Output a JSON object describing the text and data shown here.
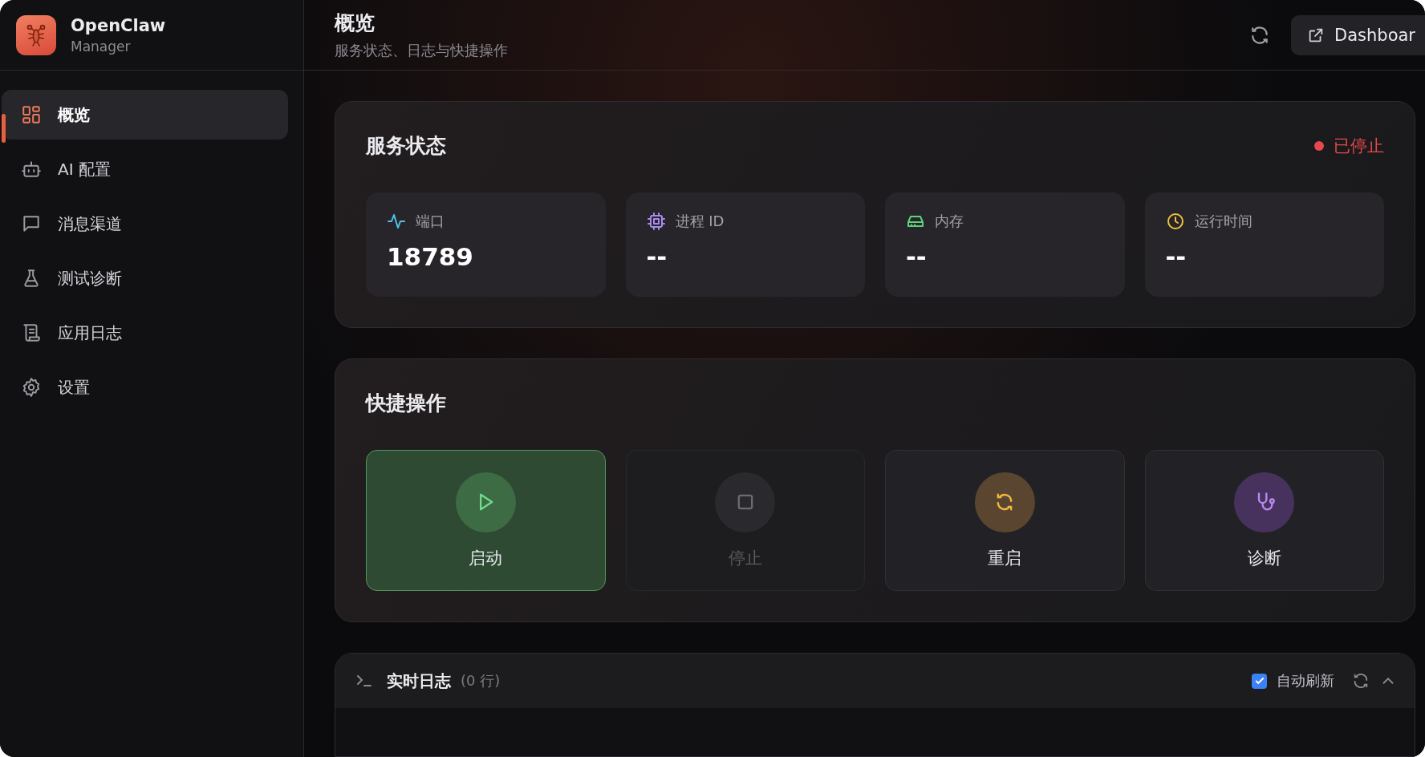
{
  "app": {
    "name": "OpenClaw",
    "subtitle": "Manager"
  },
  "sidebar": {
    "items": [
      {
        "label": "概览",
        "kind": "overview",
        "selected": true
      },
      {
        "label": "AI 配置",
        "kind": "ai",
        "selected": false
      },
      {
        "label": "消息渠道",
        "kind": "channels",
        "selected": false
      },
      {
        "label": "测试诊断",
        "kind": "test",
        "selected": false
      },
      {
        "label": "应用日志",
        "kind": "logs",
        "selected": false
      },
      {
        "label": "设置",
        "kind": "settings",
        "selected": false
      }
    ]
  },
  "header": {
    "title": "概览",
    "subtitle": "服务状态、日志与快捷操作",
    "dashboard_button": "Dashboar"
  },
  "service_status": {
    "title": "服务状态",
    "status": {
      "label": "已停止",
      "color": "#e5484d"
    },
    "stats": [
      {
        "kind": "port",
        "label": "端口",
        "value": "18789"
      },
      {
        "kind": "pid",
        "label": "进程 ID",
        "value": "--"
      },
      {
        "kind": "memory",
        "label": "内存",
        "value": "--"
      },
      {
        "kind": "uptime",
        "label": "运行时间",
        "value": "--"
      }
    ]
  },
  "quick_actions": {
    "title": "快捷操作",
    "actions": [
      {
        "kind": "start",
        "label": "启动",
        "disabled": false
      },
      {
        "kind": "stop",
        "label": "停止",
        "disabled": true
      },
      {
        "kind": "restart",
        "label": "重启",
        "disabled": false
      },
      {
        "kind": "diagnose",
        "label": "诊断",
        "disabled": false
      }
    ]
  },
  "live_log": {
    "title": "实时日志",
    "count": "(0 行)",
    "auto_refresh": {
      "label": "自动刷新",
      "checked": true
    },
    "expanded": true
  }
}
